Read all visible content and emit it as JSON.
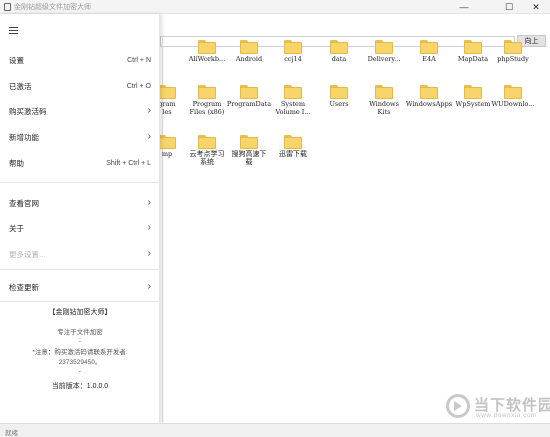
{
  "window": {
    "title": "金刚钻超级文件加密大师",
    "min_glyph": "—",
    "max_glyph": "☐",
    "close_glyph": "✕"
  },
  "toolbar": {
    "up_label": "向上"
  },
  "files": [
    {
      "name": "AliWorkb..."
    },
    {
      "name": "Android"
    },
    {
      "name": "ccj14"
    },
    {
      "name": "data"
    },
    {
      "name": "Delivery..."
    },
    {
      "name": "E4A"
    },
    {
      "name": "MapData"
    },
    {
      "name": "phpStudy"
    },
    {
      "name": "gram\nles"
    },
    {
      "name": "Program\nFiles (x86)"
    },
    {
      "name": "ProgramData"
    },
    {
      "name": "System\nVolume I..."
    },
    {
      "name": "Users"
    },
    {
      "name": "Windows\nKits"
    },
    {
      "name": "WindowsApps"
    },
    {
      "name": "WpSystem"
    },
    {
      "name": "WUDownlo..."
    },
    {
      "name": "mp"
    },
    {
      "name": "云考点学习\n系统"
    },
    {
      "name": "搜狗高速下\n载"
    },
    {
      "name": "迅雷下载"
    }
  ],
  "menu": {
    "settings": {
      "label": "设置",
      "shortcut": "Ctrl + N"
    },
    "activated": {
      "label": "已激活",
      "shortcut": "Ctrl + O"
    },
    "buy_code": {
      "label": "购买激活码",
      "chevron": "›"
    },
    "new_features": {
      "label": "新增功能",
      "chevron": "›"
    },
    "help": {
      "label": "帮助",
      "shortcut": "Shift + Ctrl + L"
    },
    "website": {
      "label": "查看官网",
      "chevron": "›"
    },
    "about": {
      "label": "关于",
      "chevron": "›"
    },
    "more_settings": {
      "label": "更多设置...",
      "chevron": "›"
    },
    "check_update": {
      "label": "检查更新",
      "chevron": "›"
    }
  },
  "info": {
    "app_name": "【金刚钻加密大师】",
    "tagline": "专注于文件加密",
    "dash1": "-",
    "notice": "*注意：购买激活码请联系开发者:",
    "contact": "2373529450。",
    "dash2": "-",
    "version": "当前版本：1.0.0.0"
  },
  "status": {
    "text": "就绪"
  },
  "watermark": {
    "name": "当下软件园",
    "url": "www.downxia.com"
  }
}
